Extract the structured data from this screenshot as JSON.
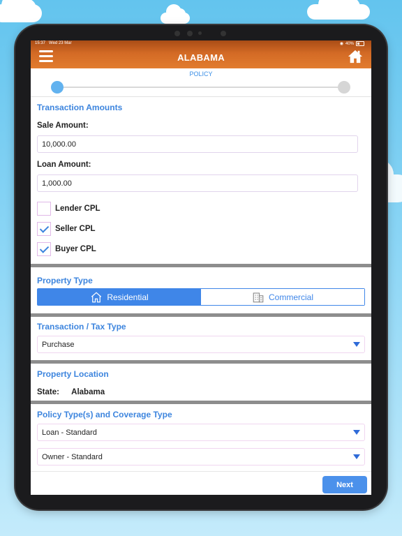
{
  "statusbar": {
    "time": "15:37",
    "date": "Wed 23 Mar",
    "battery": "40%"
  },
  "header": {
    "title": "ALABAMA"
  },
  "stepper": {
    "label": "POLICY"
  },
  "transaction": {
    "title": "Transaction Amounts",
    "sale_label": "Sale Amount:",
    "sale_value": "10,000.00",
    "loan_label": "Loan Amount:",
    "loan_value": "1,000.00",
    "checkboxes": [
      {
        "label": "Lender CPL",
        "checked": false
      },
      {
        "label": "Seller CPL",
        "checked": true
      },
      {
        "label": "Buyer CPL",
        "checked": true
      }
    ]
  },
  "property_type": {
    "title": "Property Type",
    "options": [
      {
        "label": "Residential",
        "selected": true
      },
      {
        "label": "Commercial",
        "selected": false
      }
    ]
  },
  "tax_type": {
    "title": "Transaction / Tax Type",
    "value": "Purchase"
  },
  "location": {
    "title": "Property Location",
    "state_label": "State:",
    "state_value": "Alabama"
  },
  "policy": {
    "title": "Policy Type(s) and Coverage Type",
    "loan_value": "Loan - Standard",
    "owner_value": "Owner - Standard"
  },
  "footer": {
    "next_label": "Next"
  },
  "colors": {
    "accent": "#3d85de",
    "header": "#d36a25"
  }
}
